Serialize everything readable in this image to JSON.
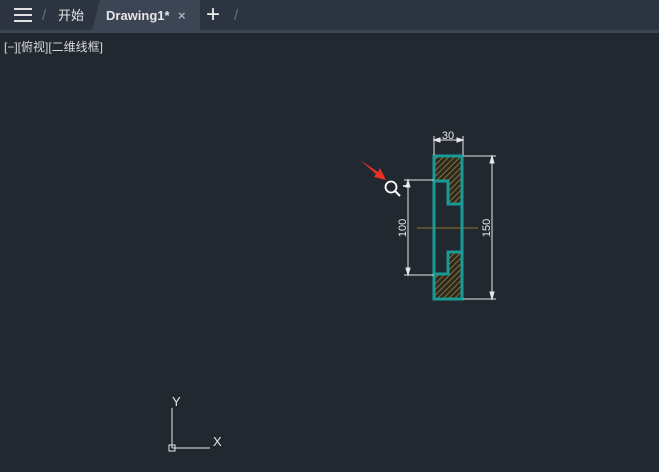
{
  "tabs": [
    {
      "label": "开始"
    },
    {
      "label": "Drawing1*",
      "active": true
    }
  ],
  "close_icon": "×",
  "new_tab_icon": "+",
  "viewport_label": "[−][俯视][二维线框]",
  "drawing": {
    "dim_width": "30",
    "dim_height": "150",
    "dim_inner": "100"
  },
  "ucs": {
    "x": "X",
    "y": "Y"
  },
  "colors": {
    "outline": "#1a9a96",
    "dimension": "#e6e6e6",
    "hatch": "#b5893b",
    "centerline": "#6b5a2a",
    "arrow": "#e8302a"
  }
}
